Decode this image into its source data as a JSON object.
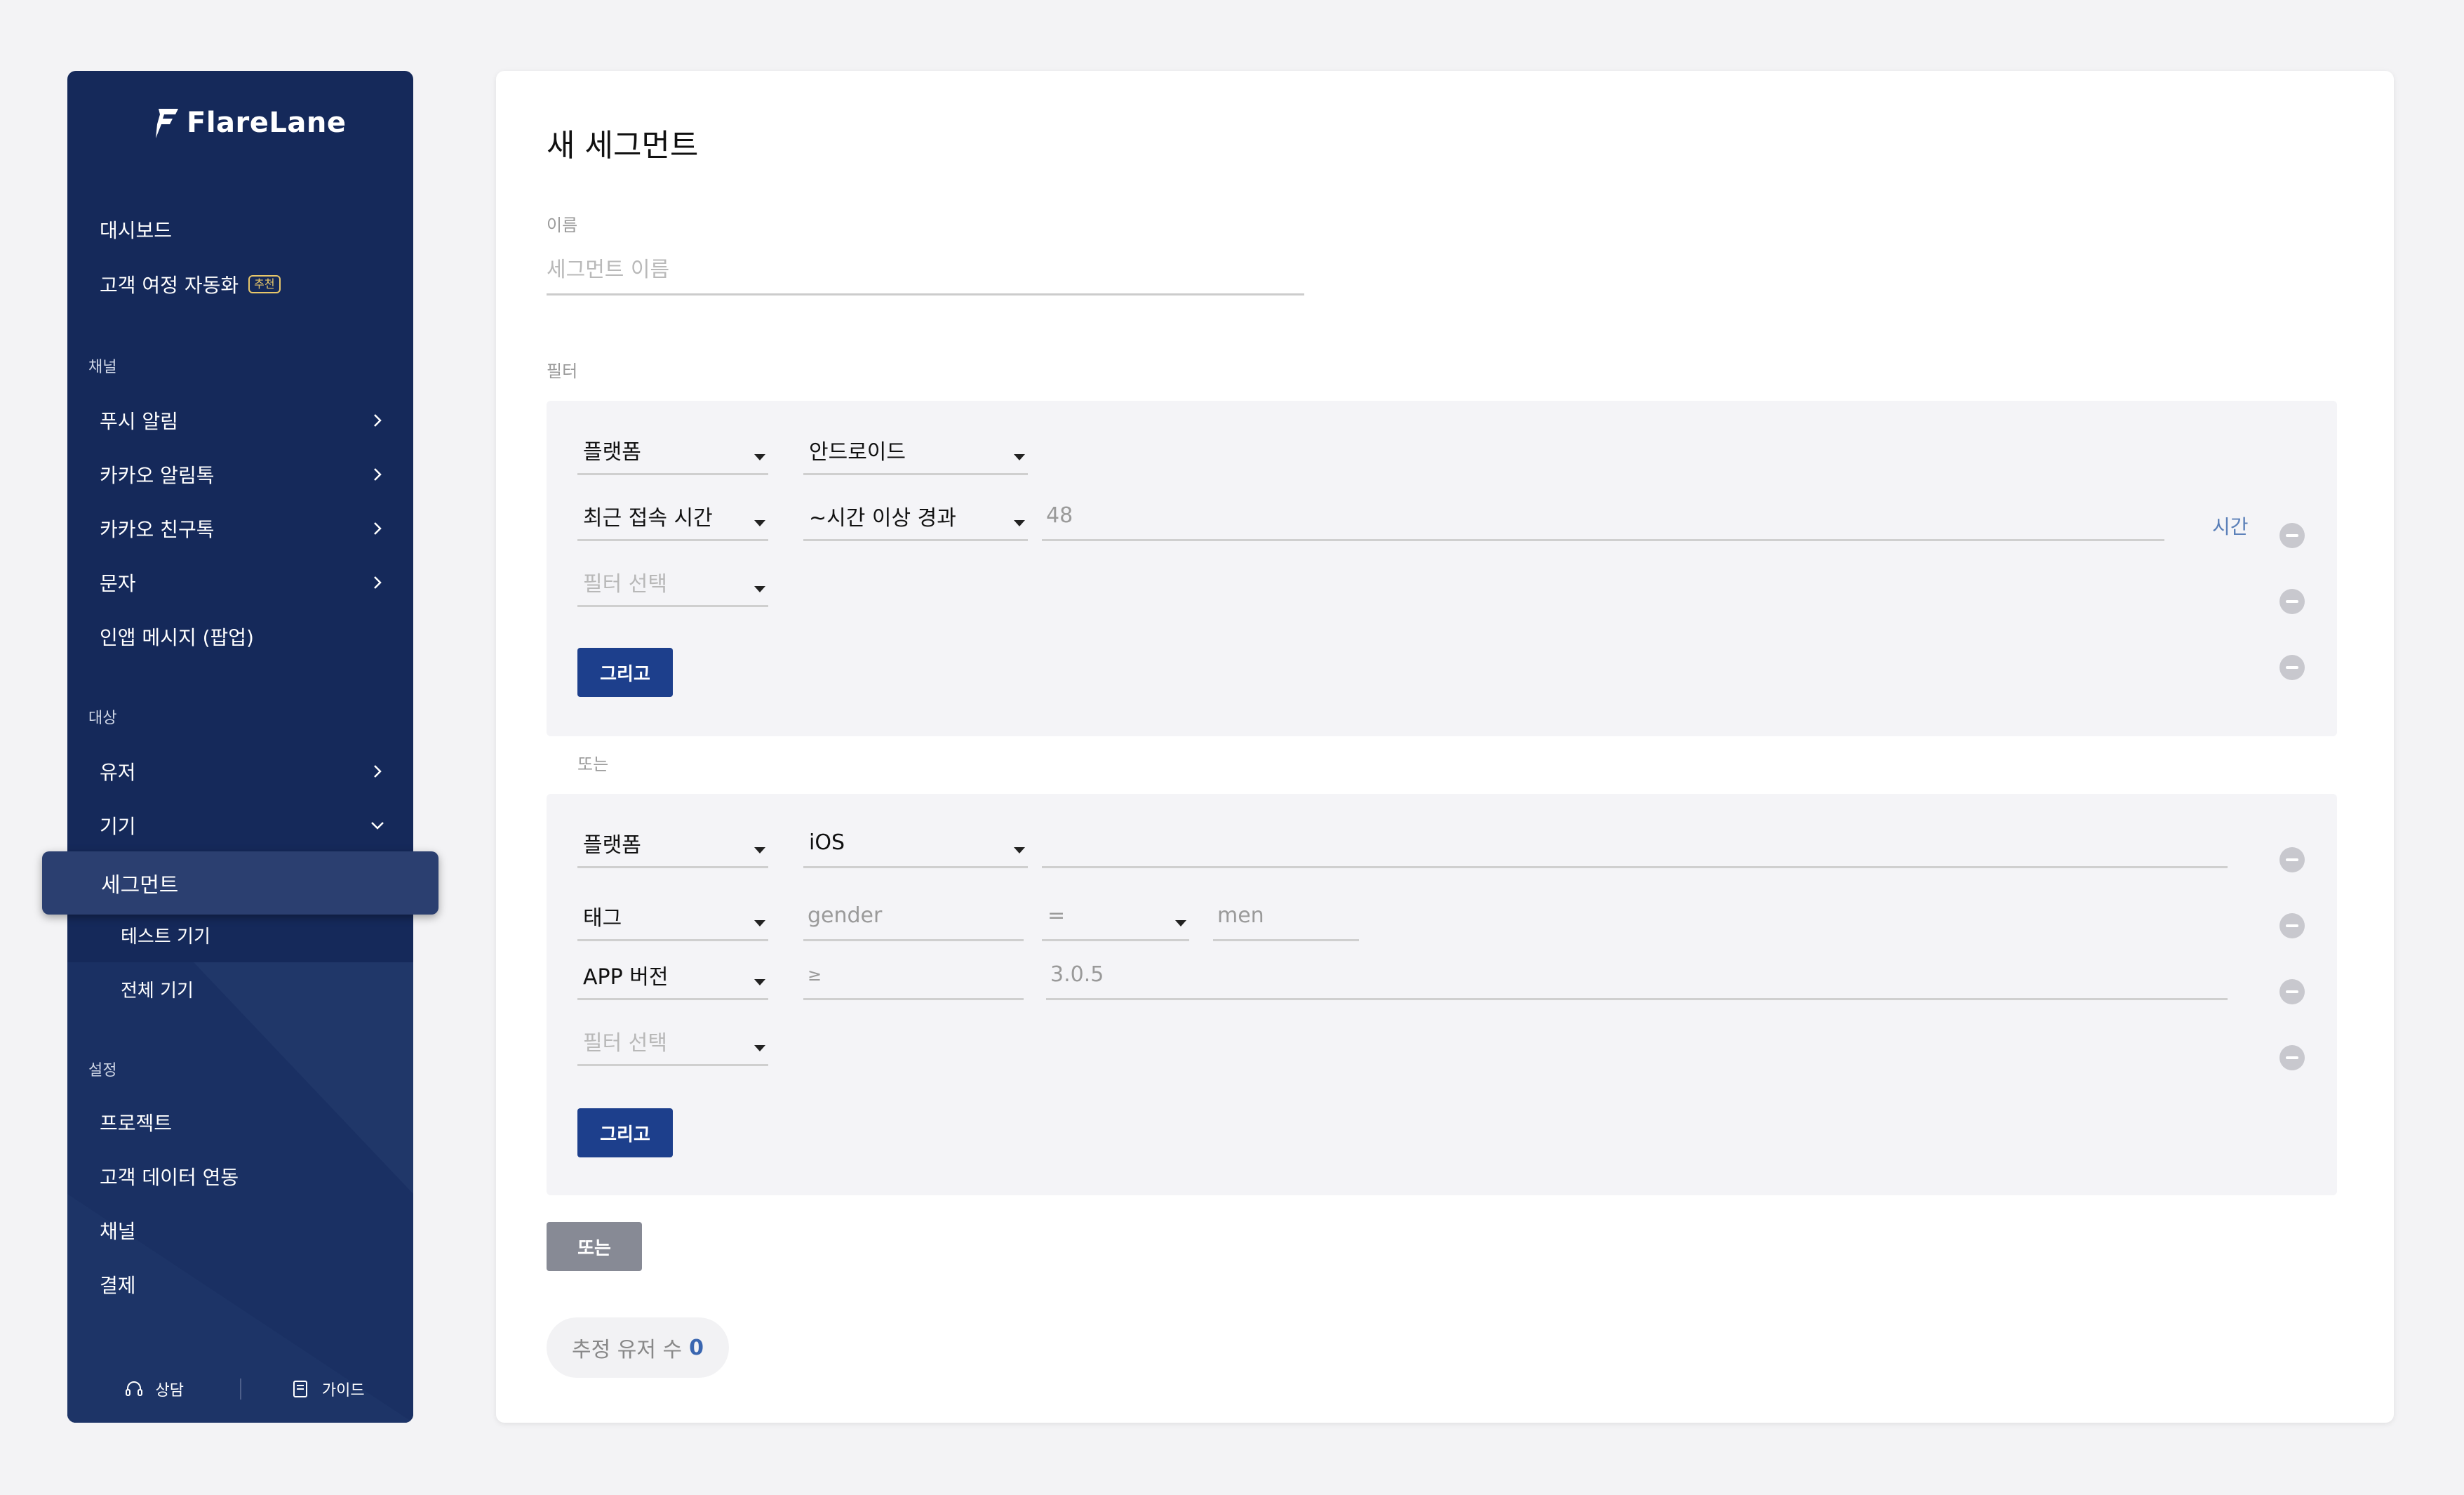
{
  "sidebar": {
    "logo": "FlareLane",
    "items": {
      "dashboard": "대시보드",
      "journey": "고객 여정 자동화",
      "journey_badge": "추천",
      "push": "푸시 알림",
      "kakao_alimtalk": "카카오 알림톡",
      "kakao_friendtalk": "카카오 친구톡",
      "sms": "문자",
      "inapp": "인앱 메시지 (팝업)",
      "users": "유저",
      "devices": "기기",
      "segment": "세그먼트",
      "test_devices": "테스트 기기",
      "all_devices": "전체 기기",
      "project": "프로젝트",
      "data_integration": "고객 데이터 연동",
      "channel": "채널",
      "billing": "결제"
    },
    "sections": {
      "channel": "채널",
      "target": "대상",
      "settings": "설정"
    },
    "footer": {
      "support": "상담",
      "guide": "가이드"
    }
  },
  "main": {
    "title": "새 세그먼트",
    "name_label": "이름",
    "name_placeholder": "세그먼트 이름",
    "filter_label": "필터",
    "group1": {
      "row1": {
        "field": "플랫폼",
        "value": "안드로이드"
      },
      "row2": {
        "field": "최근 접속 시간",
        "operator": "~시간 이상 경과",
        "value": "48",
        "unit": "시간"
      },
      "row3": {
        "placeholder": "필터 선택"
      },
      "and_button": "그리고"
    },
    "or_label": "또는",
    "group2": {
      "row1": {
        "field": "플랫폼",
        "value": "iOS"
      },
      "row2": {
        "field": "태그",
        "key": "gender",
        "operator": "=",
        "value": "men"
      },
      "row3": {
        "field": "APP 버전",
        "operator": "≥",
        "value": "3.0.5"
      },
      "row4": {
        "placeholder": "필터 선택"
      },
      "and_button": "그리고"
    },
    "or_button": "또는",
    "estimate_label": "추정 유저 수",
    "estimate_count": "0"
  },
  "colors": {
    "sidebar_bg": "#15295a",
    "primary_button": "#1d3f8c",
    "secondary_button": "#878a95",
    "accent_text": "#3a66b0",
    "badge": "#e8c76a"
  }
}
